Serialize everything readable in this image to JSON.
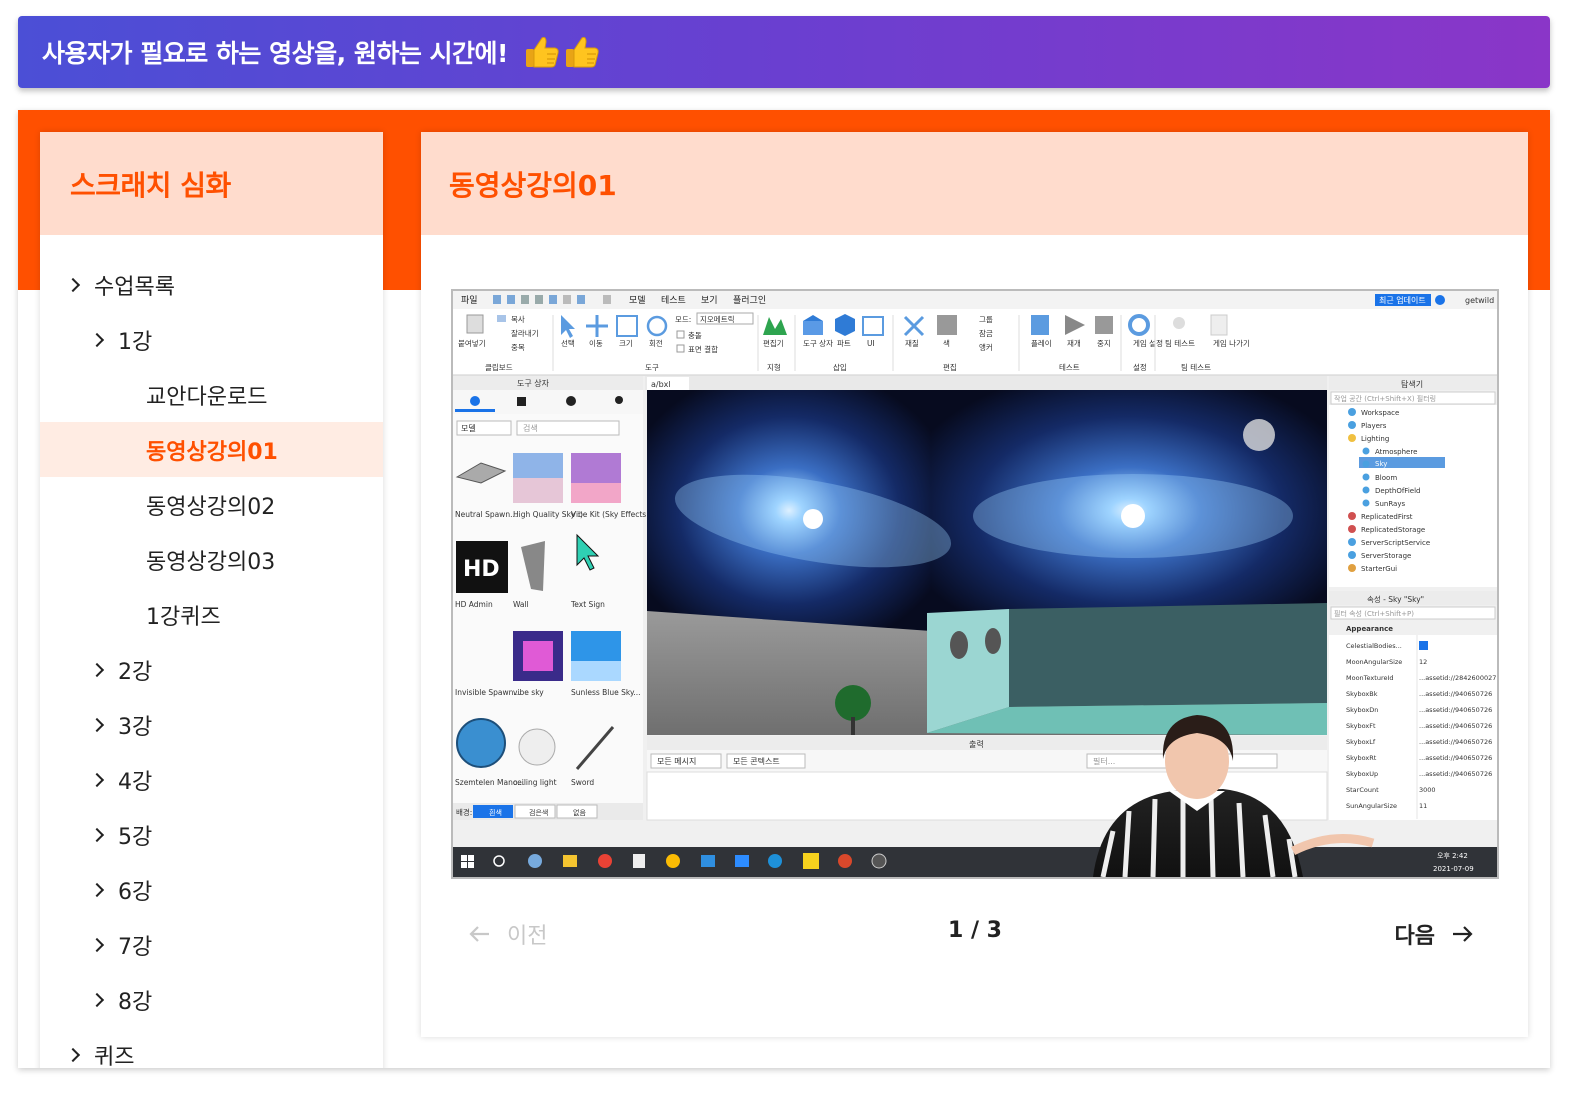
{
  "banner": {
    "text": "사용자가 필요로 하는 영상을, 원하는 시간에!"
  },
  "sidebar": {
    "title": "스크래치 심화",
    "items": [
      {
        "label": "수업목록"
      },
      {
        "label": "1강"
      },
      {
        "label": "교안다운로드"
      },
      {
        "label": "동영상강의01"
      },
      {
        "label": "동영상강의02"
      },
      {
        "label": "동영상강의03"
      },
      {
        "label": "1강퀴즈"
      },
      {
        "label": "2강"
      },
      {
        "label": "3강"
      },
      {
        "label": "4강"
      },
      {
        "label": "5강"
      },
      {
        "label": "6강"
      },
      {
        "label": "7강"
      },
      {
        "label": "8강"
      },
      {
        "label": "퀴즈"
      }
    ]
  },
  "content": {
    "title": "동영상강의01"
  },
  "screenshot": {
    "menu": [
      "파일",
      "모델",
      "테스트",
      "보기",
      "플러그인"
    ],
    "update_label": "최근 업데이트",
    "user": "getwild",
    "ribbon": {
      "clipboard": {
        "paste": "붙여넣기",
        "copy": "복사",
        "cut": "잘라내기",
        "dup": "중복",
        "group": "클립보드"
      },
      "tools": {
        "select": "선택",
        "move": "이동",
        "scale": "크기",
        "rotate": "회전",
        "mode_label": "모드:",
        "mode_value": "지오메트릭",
        "collide": "충돌",
        "join": "표면 결합",
        "group": "도구"
      },
      "terrain": {
        "editor": "편집기",
        "group": "지형"
      },
      "insert": {
        "toolbox": "도구 상자",
        "part": "파트",
        "ui": "UI",
        "group": "삽입"
      },
      "edit": {
        "material": "재질",
        "color": "색",
        "group_btn": "그룹",
        "lock": "잠금",
        "anchor": "앵커",
        "group": "편집"
      },
      "test": {
        "play": "플레이",
        "resume": "재개",
        "stop": "중지",
        "group": "테스트"
      },
      "settings": {
        "game": "게임 설정",
        "group": "설정"
      },
      "team": {
        "team_test": "팀 테스트",
        "exit": "게임 나가기",
        "group": "팀 테스트"
      }
    },
    "toolbox": {
      "title": "도구 상자",
      "dropdown": "모델",
      "search_placeholder": "검색",
      "items": [
        "Neutral Spawn...",
        "High Quality Sky :)",
        "Vibe Kit (Sky Effects Only)",
        "HD Admin",
        "Wall",
        "Text Sign",
        "Invisible Spawn...",
        "vibe sky",
        "Sunless Blue Sky...",
        "Szemtelen Mano...",
        "ceiling light",
        "Sword"
      ],
      "bg_label": "배경:",
      "bg_options": [
        "흰색",
        "검은색",
        "없음"
      ]
    },
    "viewport_tab": "a/bxl",
    "output": {
      "title": "출력",
      "msg_filter": "모든 메시지",
      "ctx_filter": "모든 콘텍스트",
      "filter_placeholder": "필터..."
    },
    "explorer": {
      "title": "탐색기",
      "filter": "작업 공간 (Ctrl+Shift+X) 필터링",
      "items": [
        "Workspace",
        "Players",
        "Lighting",
        "Atmosphere",
        "Sky",
        "Bloom",
        "DepthOfField",
        "SunRays",
        "ReplicatedFirst",
        "ReplicatedStorage",
        "ServerScriptService",
        "ServerStorage",
        "StarterGui"
      ]
    },
    "properties": {
      "title": "속성 - Sky \"Sky\"",
      "filter": "필터 속성 (Ctrl+Shift+P)",
      "section": "Appearance",
      "rows": [
        {
          "k": "CelestialBodies...",
          "v": ""
        },
        {
          "k": "MoonAngularSize",
          "v": "12"
        },
        {
          "k": "MoonTextureId",
          "v": "...assetid://2842600027"
        },
        {
          "k": "SkyboxBk",
          "v": "...assetid://940650726"
        },
        {
          "k": "SkyboxDn",
          "v": "...assetid://940650726"
        },
        {
          "k": "SkyboxFt",
          "v": "...assetid://940650726"
        },
        {
          "k": "SkyboxLf",
          "v": "...assetid://940650726"
        },
        {
          "k": "SkyboxRt",
          "v": "...assetid://940650726"
        },
        {
          "k": "SkyboxUp",
          "v": "...assetid://940650726"
        },
        {
          "k": "StarCount",
          "v": "3000"
        },
        {
          "k": "SunAngularSize",
          "v": "11"
        }
      ]
    },
    "taskbar": {
      "time": "오후 2:42",
      "date": "2021-07-09"
    }
  },
  "pager": {
    "prev": "이전",
    "page": "1 / 3",
    "next": "다음"
  }
}
